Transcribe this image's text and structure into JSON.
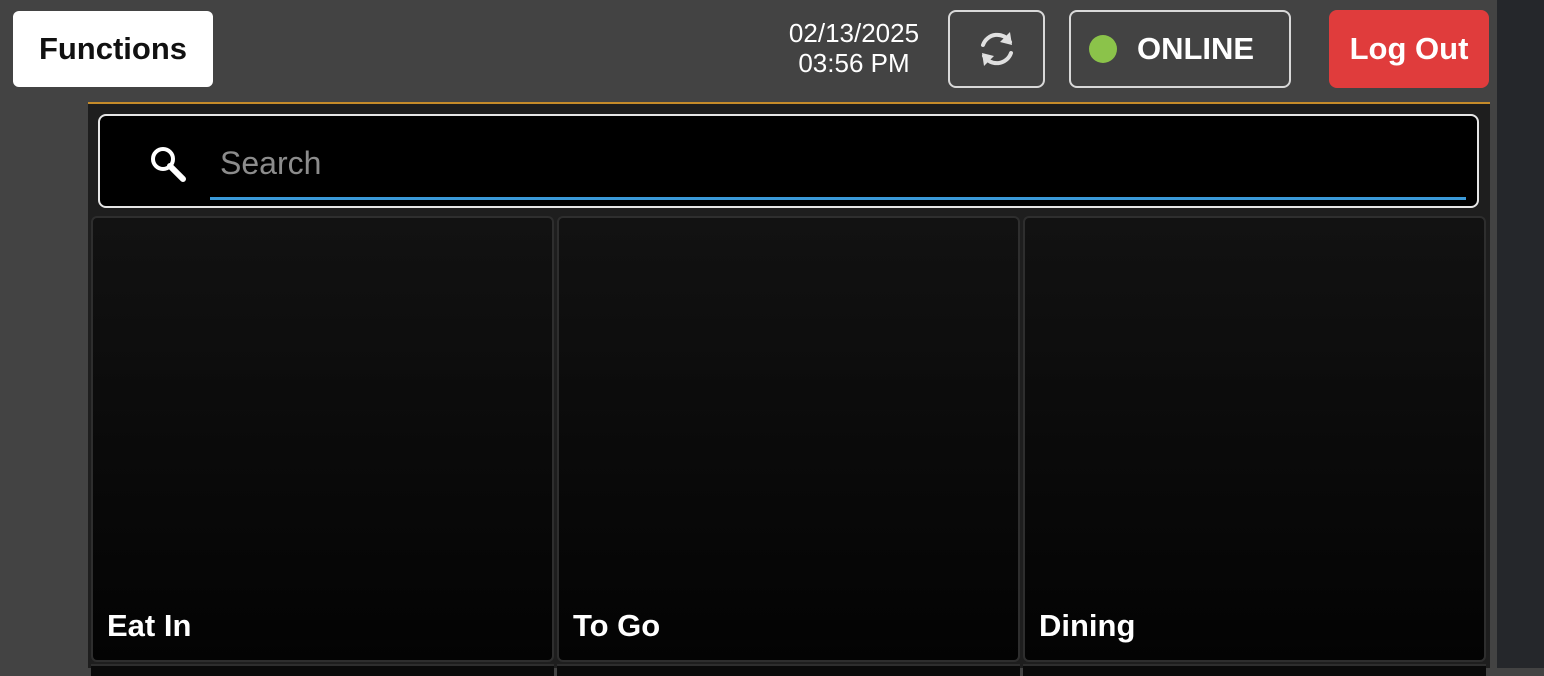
{
  "header": {
    "functions_label": "Functions",
    "date": "02/13/2025",
    "time": "03:56 PM",
    "refresh_icon": "refresh-icon",
    "status_label": "ONLINE",
    "status_color": "#8bc34a",
    "logout_label": "Log Out",
    "logout_color": "#e03c3c"
  },
  "search": {
    "placeholder": "Search",
    "icon": "search-icon"
  },
  "tiles": [
    {
      "label": "Eat In"
    },
    {
      "label": "To Go"
    },
    {
      "label": "Dining"
    }
  ]
}
